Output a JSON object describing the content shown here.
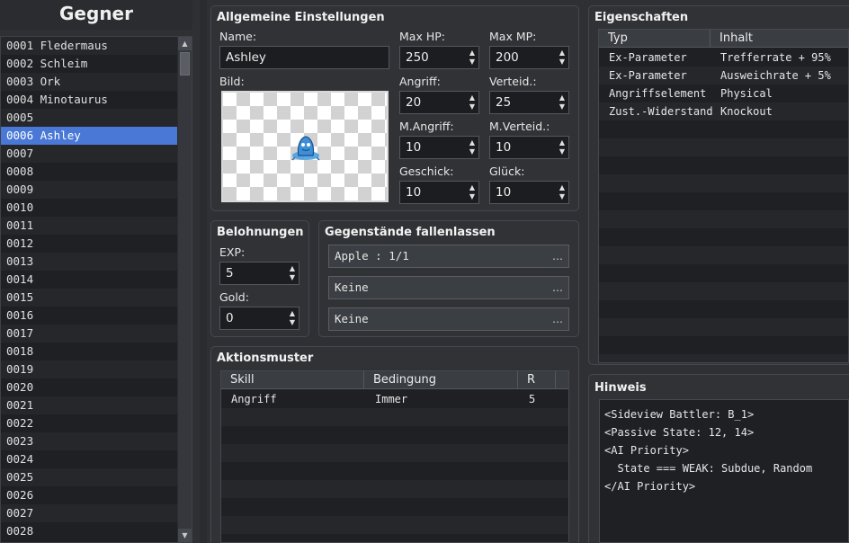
{
  "enemies": {
    "title": "Gegner",
    "items": [
      "0001 Fledermaus",
      "0002 Schleim",
      "0003 Ork",
      "0004 Minotaurus",
      "0005",
      "0006 Ashley",
      "0007",
      "0008",
      "0009",
      "0010",
      "0011",
      "0012",
      "0013",
      "0014",
      "0015",
      "0016",
      "0017",
      "0018",
      "0019",
      "0020",
      "0021",
      "0022",
      "0023",
      "0024",
      "0025",
      "0026",
      "0027",
      "0028"
    ],
    "selected_index": 5
  },
  "general": {
    "title": "Allgemeine Einstellungen",
    "name_label": "Name:",
    "name_value": "Ashley",
    "image_label": "Bild:",
    "maxhp_label": "Max HP:",
    "maxhp_value": "250",
    "maxmp_label": "Max MP:",
    "maxmp_value": "200",
    "atk_label": "Angriff:",
    "atk_value": "20",
    "def_label": "Verteid.:",
    "def_value": "25",
    "mat_label": "M.Angriff:",
    "mat_value": "10",
    "mdf_label": "M.Verteid.:",
    "mdf_value": "10",
    "agi_label": "Geschick:",
    "agi_value": "10",
    "luk_label": "Glück:",
    "luk_value": "10"
  },
  "rewards": {
    "title": "Belohnungen",
    "exp_label": "EXP:",
    "exp_value": "5",
    "gold_label": "Gold:",
    "gold_value": "0"
  },
  "drops": {
    "title": "Gegenstände fallenlassen",
    "items": [
      "Apple : 1/1",
      "Keine",
      "Keine"
    ],
    "button_glyph": "…"
  },
  "actions": {
    "title": "Aktionsmuster",
    "columns": [
      "Skill",
      "Bedingung",
      "R"
    ],
    "rows": [
      [
        "Angriff",
        "Immer",
        "5"
      ]
    ]
  },
  "traits": {
    "title": "Eigenschaften",
    "columns": [
      "Typ",
      "Inhalt"
    ],
    "rows": [
      [
        "Ex-Parameter",
        "Trefferrate + 95%"
      ],
      [
        "Ex-Parameter",
        "Ausweichrate + 5%"
      ],
      [
        "Angriffselement",
        "Physical"
      ],
      [
        "Zust.-Widerstand",
        "Knockout"
      ]
    ]
  },
  "note": {
    "title": "Hinweis",
    "lines": [
      "<Sideview Battler: B_1>",
      "<Passive State: 12, 14>",
      "<AI Priority>",
      "  State === WEAK: Subdue, Random",
      "</AI Priority>"
    ]
  },
  "icons": {
    "spin_up": "▲",
    "spin_down": "▼",
    "battler_icon": "battler-sprite-icon"
  },
  "colors": {
    "selection": "#4a78d6",
    "background": "#2e3034"
  }
}
